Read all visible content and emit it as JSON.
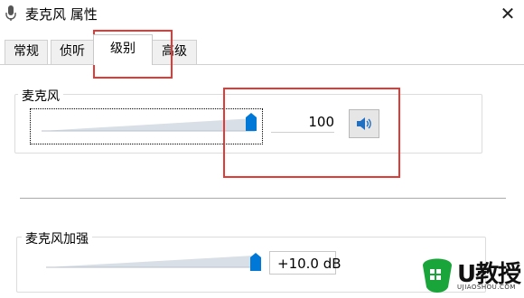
{
  "window": {
    "title": "麦克风 属性",
    "close_glyph": "✕"
  },
  "tabs": [
    {
      "label": "常规",
      "active": false
    },
    {
      "label": "侦听",
      "active": false
    },
    {
      "label": "级别",
      "active": true
    },
    {
      "label": "高级",
      "active": false
    }
  ],
  "microphone": {
    "label": "麦克风",
    "value": "100",
    "level": 1.0,
    "mute_icon": "speaker-icon"
  },
  "boost": {
    "label": "麦克风加强",
    "value": "+10.0 dB",
    "level": 1.0
  },
  "colors": {
    "accent": "#0078d7",
    "annotation": "#e53935",
    "brand_green": "#1aa53a"
  },
  "watermark": {
    "text": "U教授",
    "site": "UJIAOSHOU.COM"
  }
}
